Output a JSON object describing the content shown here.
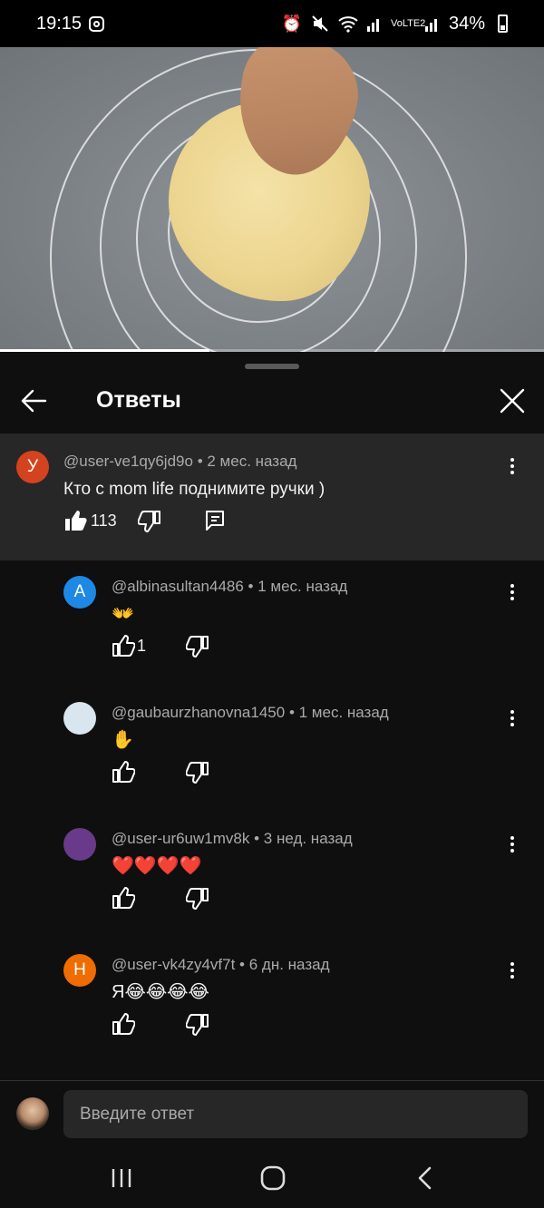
{
  "status_bar": {
    "time": "19:15",
    "battery": "34%",
    "network": "VoLTE2"
  },
  "video": {
    "progress": 0.385
  },
  "sheet": {
    "title": "Ответы"
  },
  "parent_comment": {
    "avatar_letter": "У",
    "avatar_color": "#d4431f",
    "author": "@user-ve1qy6jd9o",
    "time": "2 мес. назад",
    "text": "Кто с mom life поднимите ручки )",
    "likes": "113"
  },
  "replies": [
    {
      "avatar_letter": "А",
      "avatar_color": "#1e88e5",
      "author": "@albinasultan4486",
      "time": "1 мес. назад",
      "text": "👐",
      "likes": "1"
    },
    {
      "avatar_letter": "",
      "avatar_color": "#d9e6ef",
      "author": "@gaubaurzhanovna1450",
      "time": "1 мес. назад",
      "text": "✋",
      "likes": ""
    },
    {
      "avatar_letter": "",
      "avatar_color": "#6a3a8a",
      "author": "@user-ur6uw1mv8k",
      "time": "3 нед. назад",
      "text": "❤️❤️❤️❤️",
      "likes": ""
    },
    {
      "avatar_letter": "Н",
      "avatar_color": "#ef6c00",
      "author": "@user-vk4zy4vf7t",
      "time": "6 дн. назад",
      "text": "Я😂😂😂😂",
      "likes": ""
    }
  ],
  "input": {
    "placeholder": "Введите ответ"
  },
  "separator": "•",
  "colors": {
    "background": "#0f0f0f",
    "highlight": "#272727",
    "meta": "#aaaaaa"
  }
}
